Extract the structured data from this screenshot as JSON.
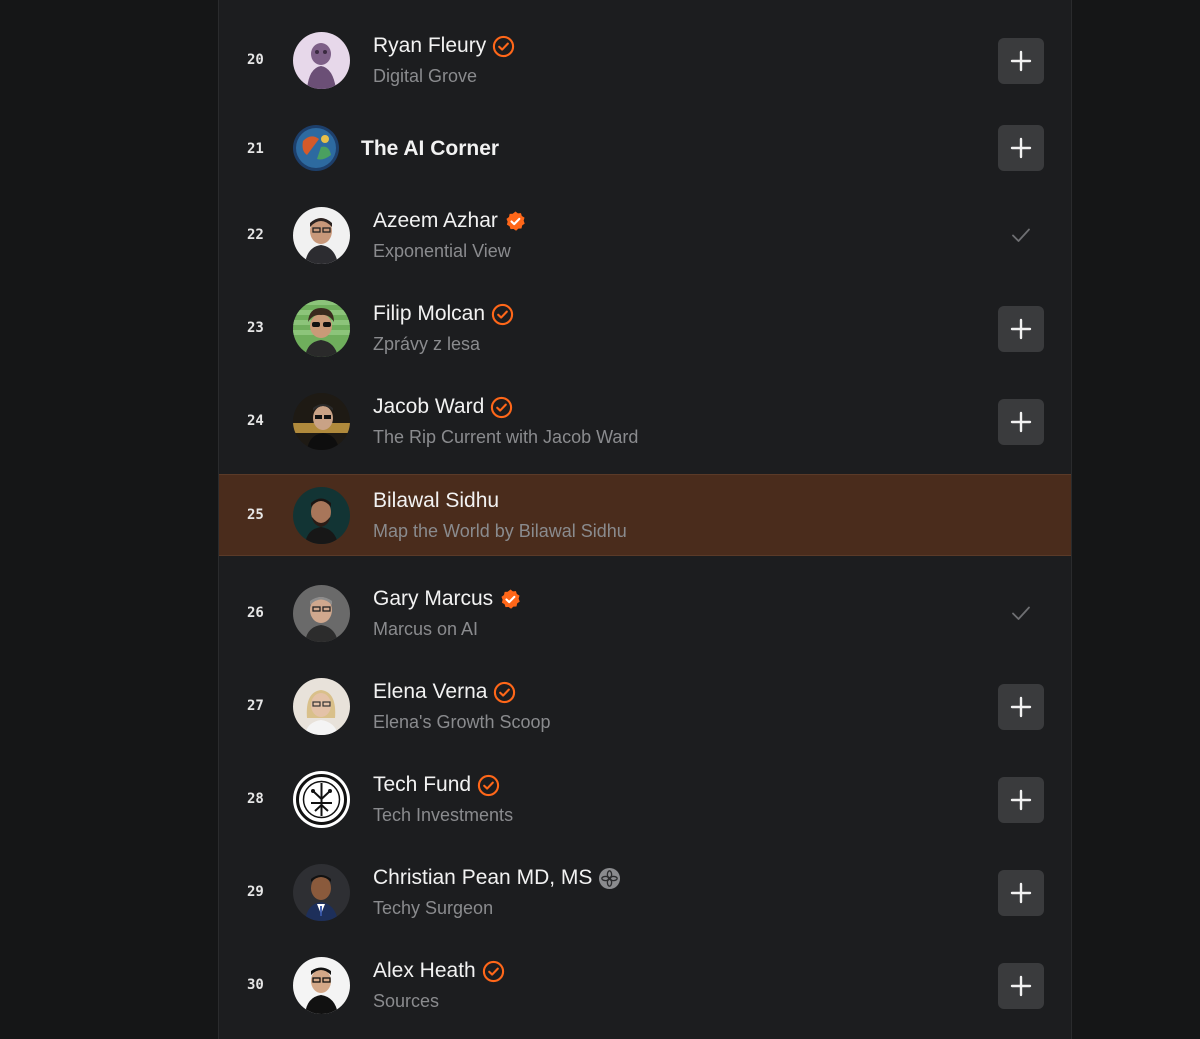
{
  "accent": "#ff6719",
  "rows": [
    {
      "rank": "20",
      "name": "Ryan Fleury",
      "sub": "Digital Grove",
      "badge": "verified-outline",
      "action": "add"
    },
    {
      "rank": "21",
      "name": "The AI Corner",
      "sub": "",
      "badge": "none",
      "action": "add"
    },
    {
      "rank": "22",
      "name": "Azeem Azhar",
      "sub": "Exponential View",
      "badge": "verified-filled",
      "action": "subscribed"
    },
    {
      "rank": "23",
      "name": "Filip Molcan",
      "sub": "Zprávy z lesa",
      "badge": "verified-outline",
      "action": "add"
    },
    {
      "rank": "24",
      "name": "Jacob Ward",
      "sub": "The Rip Current with Jacob Ward",
      "badge": "verified-outline",
      "action": "add"
    },
    {
      "rank": "25",
      "name": "Bilawal Sidhu",
      "sub": "Map the World by Bilawal Sidhu",
      "badge": "none",
      "action": "none",
      "highlighted": true
    },
    {
      "rank": "26",
      "name": "Gary Marcus",
      "sub": "Marcus on AI",
      "badge": "verified-filled",
      "action": "subscribed"
    },
    {
      "rank": "27",
      "name": "Elena Verna",
      "sub": "Elena's Growth Scoop",
      "badge": "verified-outline",
      "action": "add"
    },
    {
      "rank": "28",
      "name": "Tech Fund",
      "sub": "Tech Investments",
      "badge": "verified-outline",
      "action": "add"
    },
    {
      "rank": "29",
      "name": "Christian Pean MD, MS",
      "sub": "Techy Surgeon",
      "badge": "flower-icon",
      "action": "add"
    },
    {
      "rank": "30",
      "name": "Alex Heath",
      "sub": "Sources",
      "badge": "verified-outline",
      "action": "add"
    }
  ]
}
